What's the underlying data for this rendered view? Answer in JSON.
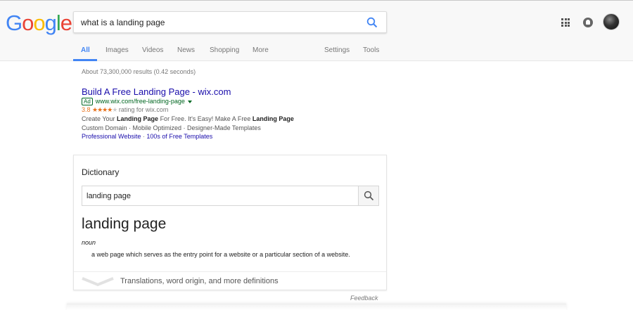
{
  "logo": {
    "letters": [
      {
        "ch": "G",
        "color": "#4285f4"
      },
      {
        "ch": "o",
        "color": "#ea4335"
      },
      {
        "ch": "o",
        "color": "#fbbc05"
      },
      {
        "ch": "g",
        "color": "#4285f4"
      },
      {
        "ch": "l",
        "color": "#34a853"
      },
      {
        "ch": "e",
        "color": "#ea4335"
      }
    ]
  },
  "search": {
    "query": "what is a landing page",
    "icon": "search-icon"
  },
  "header_icons": {
    "apps": "apps-grid-icon",
    "notifications": "notifications-icon",
    "account": "account-avatar"
  },
  "tabs": {
    "all": "All",
    "images": "Images",
    "videos": "Videos",
    "news": "News",
    "shopping": "Shopping",
    "more": "More",
    "settings": "Settings",
    "tools": "Tools"
  },
  "stats": "About 73,300,000 results (0.42 seconds)",
  "ad": {
    "title": "Build A Free Landing Page - wix.com",
    "badge": "Ad",
    "url": "www.wix.com/free-landing-page",
    "rating_value": "3.8",
    "stars_filled": "★★★★",
    "stars_empty": "★",
    "rating_text": "rating for wix.com",
    "desc1_a": "Create Your ",
    "desc1_b": "Landing Page",
    "desc1_c": " For Free. It's Easy! Make A Free ",
    "desc1_d": "Landing Page",
    "desc2": "Custom Domain · Mobile Optimized · Designer-Made Templates",
    "sitelink1": "Professional Website",
    "sitelink_sep": " · ",
    "sitelink2": "100s of Free Templates"
  },
  "dictionary": {
    "label": "Dictionary",
    "input_value": "landing page",
    "word": "landing page",
    "part_of_speech": "noun",
    "definition": "a web page which serves as the entry point for a website or a particular section of a website.",
    "more": "Translations, word origin, and more definitions"
  },
  "feedback": "Feedback",
  "colors": {
    "accent": "#4285f4",
    "link": "#1a0dab",
    "url_green": "#006621",
    "rating": "#e7711b"
  }
}
